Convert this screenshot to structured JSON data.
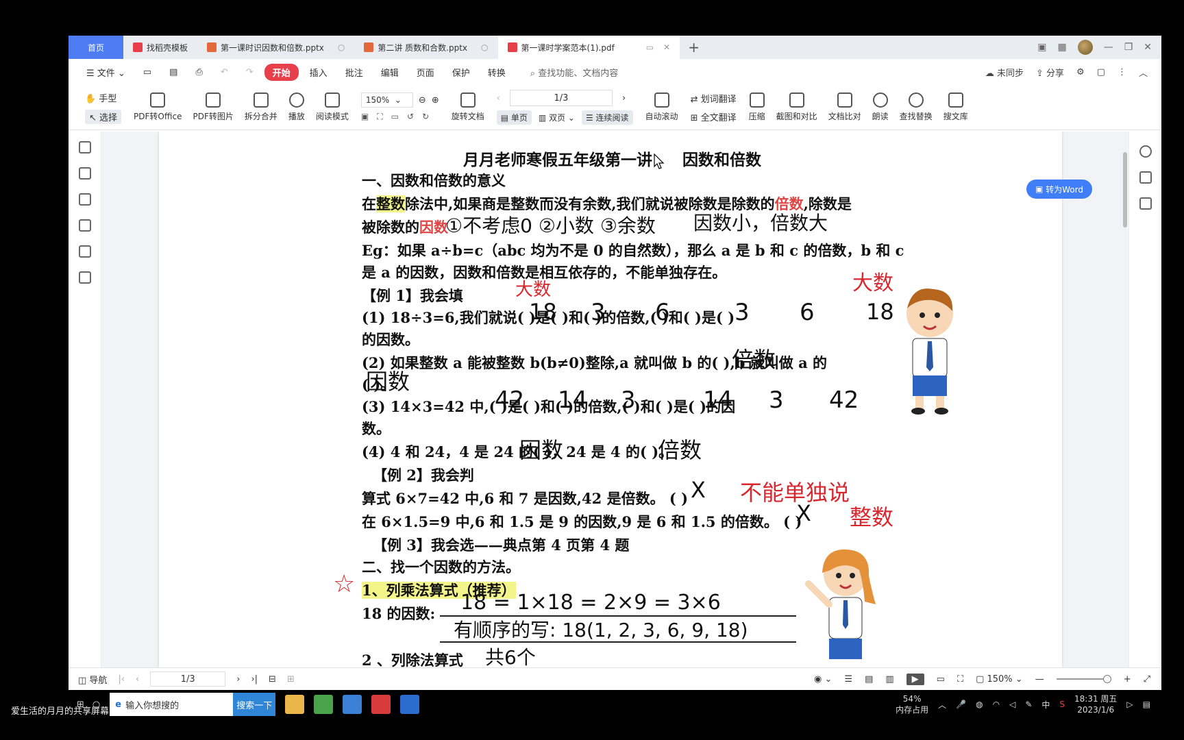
{
  "tabs": [
    {
      "label": "首页",
      "type": "home"
    },
    {
      "label": "找稻壳模板",
      "color": "#e8404a"
    },
    {
      "label": "第一课时识因数和倍数.pptx",
      "color": "#e3683b"
    },
    {
      "label": "第二讲   质数和合数.pptx",
      "color": "#e3683b"
    },
    {
      "label": "第一课时学案范本(1).pdf",
      "color": "#e8404a",
      "active": true
    }
  ],
  "menu": {
    "file": "文件",
    "items": [
      "开始",
      "插入",
      "批注",
      "编辑",
      "页面",
      "保护",
      "转换"
    ],
    "search": "查找功能、文档内容",
    "sync": "未同步",
    "share": "分享"
  },
  "toolbar": {
    "hand": "手型",
    "select": "选择",
    "pdf_office": "PDF转Office",
    "pdf_image": "PDF转图片",
    "split": "拆分合并",
    "play": "播放",
    "read_mode": "阅读模式",
    "zoom": "150%",
    "rotate": "旋转文档",
    "page": "1/3",
    "single": "单页",
    "double": "双页",
    "continuous": "连续阅读",
    "auto_scroll": "自动滚动",
    "word_translate": "划词翻译",
    "full_translate": "全文翻译",
    "compress": "压缩",
    "screenshot": "截图和对比",
    "compare": "文档比对",
    "read_aloud": "朗读",
    "find_replace": "查找替换",
    "library": "搜文库",
    "to_word": "转为Word"
  },
  "doc": {
    "title": "月月老师寒假五年级第一讲",
    "title2": "因数和倍数",
    "h1": "一、因数和倍数的意义",
    "p1a": "在",
    "p1b": "整数",
    "p1c": "除法中,如果商是整数而没有余数,我们就说被除数是除数的",
    "p1d": "倍数",
    "p1e": ",除数是",
    "p2a": "被除数的",
    "p2b": "因数",
    "eg1": "Eg：如果 a÷b=c（abc 均为不是 0 的自然数），那么 a 是 b 和 c 的倍数，b 和 c",
    "eg2": "是 a 的因数，因数和倍数是相互依存的，不能单独存在。",
    "ex1": "【例 1】我会填",
    "q1": "(1)  18÷3=6,我们就说(      )是(      )和(      )的倍数,(      )和(      )是(      )",
    "q1b": "的因数。",
    "q2": "(2)  如果整数 a 能被整数 b(b≠0)整除,a 就叫做 b 的(          ),b 就叫做 a 的",
    "q2b": "(          )。",
    "q3": "(3)  14×3=42 中,(      )是(      )和(      )的倍数,(      )和(      )是(      )的因",
    "q3b": "数。",
    "q4": "(4) 4 和 24，4 是 24 的(          )，24 是 4 的(          )。",
    "ex2": "【例 2】我会判",
    "j1": "算式 6×7=42 中,6 和 7 是因数,42 是倍数。     (        )",
    "j2": "在 6×1.5=9 中,6 和 1.5 是 9 的因数,9 是 6 和 1.5 的倍数。    (        )",
    "ex3": "【例 3】我会选——典点第 4 页第 4 题",
    "h2": "二、找一个因数的方法。",
    "m1": "1、列乘法算式（推荐）",
    "m1b": "18 的因数:",
    "m2": "2 、列除法算式"
  },
  "handwriting": {
    "note1": "①不考虑0 ②小数 ③余数",
    "note2": "因数小，倍数大",
    "big": "大数",
    "big2": "大数",
    "a18": "18",
    "a3": "3",
    "a6": "6",
    "a3b": "3",
    "a6b": "6",
    "a18b": "18",
    "multiple": "倍数",
    "factor": "因数",
    "a42": "42",
    "a14": "14",
    "a3c": "3",
    "a14b": "14",
    "a3d": "3",
    "a42b": "42",
    "factor2": "因数",
    "multiple2": "倍数",
    "x1": "X",
    "cannot": "不能单独说",
    "x2": "X",
    "integer": "整数",
    "star": "☆",
    "mult_eq": "18 = 1×18 = 2×9 = 3×6",
    "ordered": "有顺序的写: 18(1, 2, 3, 6, 9, 18)",
    "total": "共6个"
  },
  "status": {
    "nav": "导航",
    "page": "1/3",
    "zoom": "150%"
  },
  "taskbar": {
    "search_placeholder": "输入你想搜的",
    "search_btn": "搜索一下",
    "mem_pct": "54%",
    "mem_label": "内存占用",
    "ime": "中",
    "time": "18:31 周五",
    "date": "2023/1/6"
  },
  "watermark": "爱生活的月月的共享屏幕"
}
